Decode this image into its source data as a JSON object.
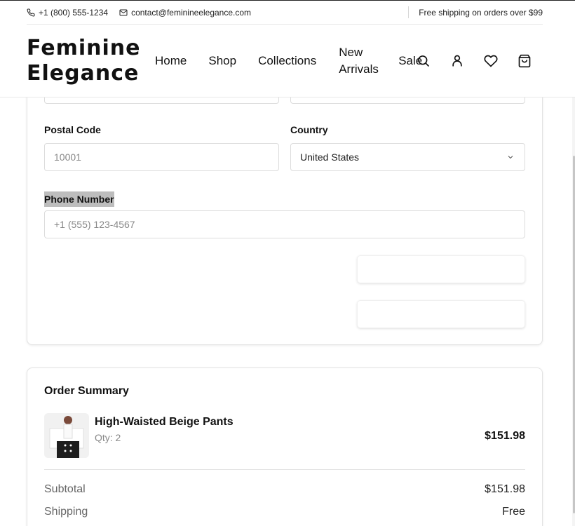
{
  "topbar": {
    "phone": "+1 (800) 555-1234",
    "email": "contact@feminineelegance.com",
    "shipping_note": "Free shipping on orders over $99"
  },
  "header": {
    "logo_line1": "Feminine",
    "logo_line2": "Elegance",
    "nav": {
      "home": "Home",
      "shop": "Shop",
      "collections": "Collections",
      "new_line1": "New",
      "new_line2": "Arrivals",
      "sale": "Sale"
    },
    "icons": [
      "search-icon",
      "user-icon",
      "heart-icon",
      "cart-icon"
    ]
  },
  "form": {
    "postal_code": {
      "label": "Postal Code",
      "placeholder": "10001"
    },
    "country": {
      "label": "Country",
      "value": "United States"
    },
    "phone": {
      "label": "Phone Number",
      "placeholder": "+1 (555) 123-4567"
    }
  },
  "summary": {
    "title": "Order Summary",
    "item": {
      "name": "High-Waisted Beige Pants",
      "qty": "Qty: 2",
      "price": "$151.98"
    },
    "subtotal_label": "Subtotal",
    "subtotal_value": "$151.98",
    "shipping_label": "Shipping",
    "shipping_value": "Free"
  }
}
